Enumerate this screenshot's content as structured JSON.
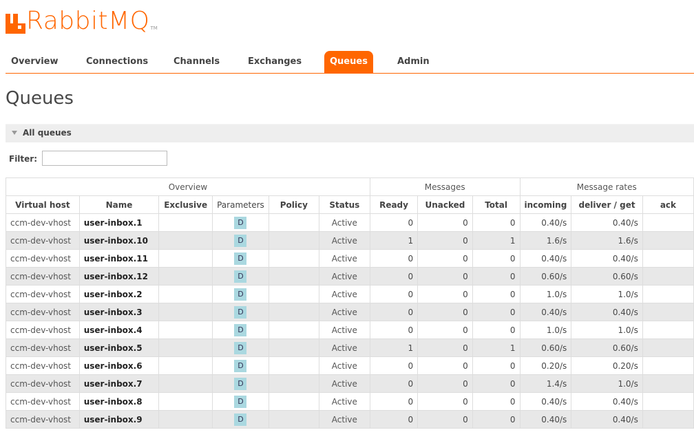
{
  "app": {
    "name": "RabbitMQ",
    "tm": "TM",
    "brand_color": "#ff6600"
  },
  "nav": [
    {
      "label": "Overview",
      "active": false
    },
    {
      "label": "Connections",
      "active": false
    },
    {
      "label": "Channels",
      "active": false
    },
    {
      "label": "Exchanges",
      "active": false
    },
    {
      "label": "Queues",
      "active": true
    },
    {
      "label": "Admin",
      "active": false
    }
  ],
  "page": {
    "title": "Queues"
  },
  "section": {
    "label": "All queues"
  },
  "filter": {
    "label": "Filter:",
    "value": ""
  },
  "table": {
    "groups": [
      "Overview",
      "Messages",
      "Message rates"
    ],
    "columns": [
      "Virtual host",
      "Name",
      "Exclusive",
      "Parameters",
      "Policy",
      "Status",
      "Ready",
      "Unacked",
      "Total",
      "incoming",
      "deliver / get",
      "ack"
    ],
    "rows": [
      {
        "vhost": "ccm-dev-vhost",
        "name": "user-inbox.1",
        "exclusive": "",
        "param": "D",
        "policy": "",
        "status": "Active",
        "ready": "0",
        "unacked": "0",
        "total": "0",
        "incoming": "0.40/s",
        "deliver": "0.40/s",
        "ack": ""
      },
      {
        "vhost": "ccm-dev-vhost",
        "name": "user-inbox.10",
        "exclusive": "",
        "param": "D",
        "policy": "",
        "status": "Active",
        "ready": "1",
        "unacked": "0",
        "total": "1",
        "incoming": "1.6/s",
        "deliver": "1.6/s",
        "ack": ""
      },
      {
        "vhost": "ccm-dev-vhost",
        "name": "user-inbox.11",
        "exclusive": "",
        "param": "D",
        "policy": "",
        "status": "Active",
        "ready": "0",
        "unacked": "0",
        "total": "0",
        "incoming": "0.40/s",
        "deliver": "0.40/s",
        "ack": ""
      },
      {
        "vhost": "ccm-dev-vhost",
        "name": "user-inbox.12",
        "exclusive": "",
        "param": "D",
        "policy": "",
        "status": "Active",
        "ready": "0",
        "unacked": "0",
        "total": "0",
        "incoming": "0.60/s",
        "deliver": "0.60/s",
        "ack": ""
      },
      {
        "vhost": "ccm-dev-vhost",
        "name": "user-inbox.2",
        "exclusive": "",
        "param": "D",
        "policy": "",
        "status": "Active",
        "ready": "0",
        "unacked": "0",
        "total": "0",
        "incoming": "1.0/s",
        "deliver": "1.0/s",
        "ack": ""
      },
      {
        "vhost": "ccm-dev-vhost",
        "name": "user-inbox.3",
        "exclusive": "",
        "param": "D",
        "policy": "",
        "status": "Active",
        "ready": "0",
        "unacked": "0",
        "total": "0",
        "incoming": "0.40/s",
        "deliver": "0.40/s",
        "ack": ""
      },
      {
        "vhost": "ccm-dev-vhost",
        "name": "user-inbox.4",
        "exclusive": "",
        "param": "D",
        "policy": "",
        "status": "Active",
        "ready": "0",
        "unacked": "0",
        "total": "0",
        "incoming": "1.0/s",
        "deliver": "1.0/s",
        "ack": ""
      },
      {
        "vhost": "ccm-dev-vhost",
        "name": "user-inbox.5",
        "exclusive": "",
        "param": "D",
        "policy": "",
        "status": "Active",
        "ready": "1",
        "unacked": "0",
        "total": "1",
        "incoming": "0.60/s",
        "deliver": "0.60/s",
        "ack": ""
      },
      {
        "vhost": "ccm-dev-vhost",
        "name": "user-inbox.6",
        "exclusive": "",
        "param": "D",
        "policy": "",
        "status": "Active",
        "ready": "0",
        "unacked": "0",
        "total": "0",
        "incoming": "0.20/s",
        "deliver": "0.20/s",
        "ack": ""
      },
      {
        "vhost": "ccm-dev-vhost",
        "name": "user-inbox.7",
        "exclusive": "",
        "param": "D",
        "policy": "",
        "status": "Active",
        "ready": "0",
        "unacked": "0",
        "total": "0",
        "incoming": "1.4/s",
        "deliver": "1.0/s",
        "ack": ""
      },
      {
        "vhost": "ccm-dev-vhost",
        "name": "user-inbox.8",
        "exclusive": "",
        "param": "D",
        "policy": "",
        "status": "Active",
        "ready": "0",
        "unacked": "0",
        "total": "0",
        "incoming": "0.40/s",
        "deliver": "0.40/s",
        "ack": ""
      },
      {
        "vhost": "ccm-dev-vhost",
        "name": "user-inbox.9",
        "exclusive": "",
        "param": "D",
        "policy": "",
        "status": "Active",
        "ready": "0",
        "unacked": "0",
        "total": "0",
        "incoming": "0.40/s",
        "deliver": "0.40/s",
        "ack": ""
      }
    ]
  }
}
